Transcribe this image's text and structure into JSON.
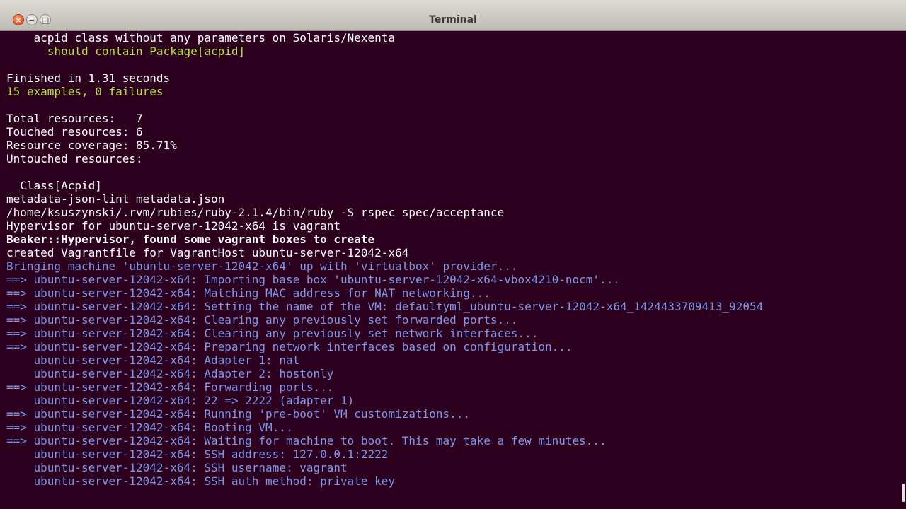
{
  "window": {
    "title": "Terminal"
  },
  "colors": {
    "background": "#2c001e",
    "text_white": "#ffffff",
    "text_green": "#b5e23c",
    "text_blue": "#7e97e8"
  },
  "terminal": {
    "lines": [
      {
        "text": "    acpid class without any parameters on Solaris/Nexenta",
        "color": "white"
      },
      {
        "text": "      should contain Package[acpid]",
        "color": "green"
      },
      {
        "text": "",
        "color": "white"
      },
      {
        "text": "Finished in 1.31 seconds",
        "color": "white"
      },
      {
        "text": "15 examples, 0 failures",
        "color": "green"
      },
      {
        "text": "",
        "color": "white"
      },
      {
        "text": "Total resources:   7",
        "color": "white"
      },
      {
        "text": "Touched resources: 6",
        "color": "white"
      },
      {
        "text": "Resource coverage: 85.71%",
        "color": "white"
      },
      {
        "text": "Untouched resources:",
        "color": "white"
      },
      {
        "text": "",
        "color": "white"
      },
      {
        "text": "  Class[Acpid]",
        "color": "white"
      },
      {
        "text": "metadata-json-lint metadata.json",
        "color": "white"
      },
      {
        "text": "/home/ksuszynski/.rvm/rubies/ruby-2.1.4/bin/ruby -S rspec spec/acceptance",
        "color": "white"
      },
      {
        "text": "Hypervisor for ubuntu-server-12042-x64 is vagrant",
        "color": "white"
      },
      {
        "text": "Beaker::Hypervisor, found some vagrant boxes to create",
        "color": "white",
        "bold": true
      },
      {
        "text": "created Vagrantfile for VagrantHost ubuntu-server-12042-x64",
        "color": "white"
      },
      {
        "text": "Bringing machine 'ubuntu-server-12042-x64' up with 'virtualbox' provider...",
        "color": "blue"
      },
      {
        "text": "==> ubuntu-server-12042-x64: Importing base box 'ubuntu-server-12042-x64-vbox4210-nocm'...",
        "color": "blue"
      },
      {
        "text": "==> ubuntu-server-12042-x64: Matching MAC address for NAT networking...",
        "color": "blue"
      },
      {
        "text": "==> ubuntu-server-12042-x64: Setting the name of the VM: defaultyml_ubuntu-server-12042-x64_1424433709413_92054",
        "color": "blue"
      },
      {
        "text": "==> ubuntu-server-12042-x64: Clearing any previously set forwarded ports...",
        "color": "blue"
      },
      {
        "text": "==> ubuntu-server-12042-x64: Clearing any previously set network interfaces...",
        "color": "blue"
      },
      {
        "text": "==> ubuntu-server-12042-x64: Preparing network interfaces based on configuration...",
        "color": "blue"
      },
      {
        "text": "    ubuntu-server-12042-x64: Adapter 1: nat",
        "color": "blue"
      },
      {
        "text": "    ubuntu-server-12042-x64: Adapter 2: hostonly",
        "color": "blue"
      },
      {
        "text": "==> ubuntu-server-12042-x64: Forwarding ports...",
        "color": "blue"
      },
      {
        "text": "    ubuntu-server-12042-x64: 22 => 2222 (adapter 1)",
        "color": "blue"
      },
      {
        "text": "==> ubuntu-server-12042-x64: Running 'pre-boot' VM customizations...",
        "color": "blue"
      },
      {
        "text": "==> ubuntu-server-12042-x64: Booting VM...",
        "color": "blue"
      },
      {
        "text": "==> ubuntu-server-12042-x64: Waiting for machine to boot. This may take a few minutes...",
        "color": "blue"
      },
      {
        "text": "    ubuntu-server-12042-x64: SSH address: 127.0.0.1:2222",
        "color": "blue"
      },
      {
        "text": "    ubuntu-server-12042-x64: SSH username: vagrant",
        "color": "blue"
      },
      {
        "text": "    ubuntu-server-12042-x64: SSH auth method: private key",
        "color": "blue"
      }
    ]
  }
}
